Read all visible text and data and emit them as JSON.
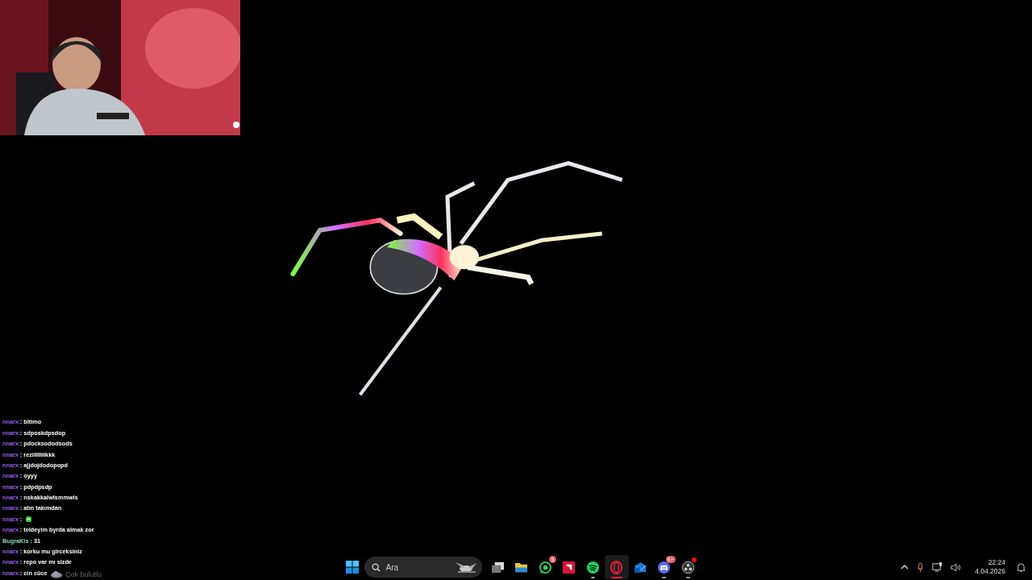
{
  "chat": [
    {
      "user": "nnarx",
      "color": "#9b5cf6",
      "kind": "text",
      "separator": ":",
      "message": "bitimo"
    },
    {
      "user": "nnarx",
      "color": "#9b5cf6",
      "kind": "text",
      "separator": ":",
      "message": "sdposkdpsdop"
    },
    {
      "user": "nnarx",
      "color": "#9b5cf6",
      "kind": "text",
      "separator": ":",
      "message": "pdocksododsods"
    },
    {
      "user": "nnarx",
      "color": "#9b5cf6",
      "kind": "text",
      "separator": ":",
      "message": "rezillllliikkk"
    },
    {
      "user": "nnarx",
      "color": "#9b5cf6",
      "kind": "text",
      "separator": ":",
      "message": "ajjdojdodopopd"
    },
    {
      "user": "nnarx",
      "color": "#9b5cf6",
      "kind": "text",
      "separator": ":",
      "message": "oyyy"
    },
    {
      "user": "nnarx",
      "color": "#9b5cf6",
      "kind": "text",
      "separator": ":",
      "message": "pdpdpsdp"
    },
    {
      "user": "nnarx",
      "color": "#9b5cf6",
      "kind": "text",
      "separator": ":",
      "message": "nskakkalwlsmmwls"
    },
    {
      "user": "nnarx",
      "color": "#9b5cf6",
      "kind": "text",
      "separator": ":",
      "message": "atın takımdan"
    },
    {
      "user": "nnarx",
      "color": "#9b5cf6",
      "kind": "emote",
      "separator": ":"
    },
    {
      "user": "nnarx",
      "color": "#9b5cf6",
      "kind": "text",
      "separator": ":",
      "message": "teldeyim byrda almak zor"
    },
    {
      "user": "BugraKls",
      "color": "#7fe0b8",
      "kind": "text",
      "separator": ":",
      "message": "31"
    },
    {
      "user": "nnarx",
      "color": "#9b5cf6",
      "kind": "text",
      "separator": ":",
      "message": "korku mu girceksiniz"
    },
    {
      "user": "nnarx",
      "color": "#9b5cf6",
      "kind": "text",
      "separator": ":",
      "message": "repo var mı sizde"
    },
    {
      "user": "nnarx",
      "color": "#9b5cf6",
      "kind": "text",
      "separator": ":",
      "message": "cin cüce"
    }
  ],
  "weather": {
    "text": "Çok bulutlu"
  },
  "taskbar": {
    "search": {
      "placeholder": "Ara"
    },
    "apps": [
      {
        "kind": "taskview",
        "running": false,
        "selected": false
      },
      {
        "kind": "folder",
        "running": false,
        "selected": false
      },
      {
        "kind": "whatsapp",
        "running": false,
        "selected": false,
        "badge": "9"
      },
      {
        "kind": "amd",
        "running": false,
        "selected": false
      },
      {
        "kind": "spotify",
        "running": true,
        "selected": false
      },
      {
        "kind": "opera",
        "running": true,
        "selected": true
      },
      {
        "kind": "mail",
        "running": false,
        "selected": false
      },
      {
        "kind": "discord",
        "running": true,
        "selected": false,
        "badge": "9+"
      },
      {
        "kind": "obs",
        "running": true,
        "selected": false,
        "dot": true
      }
    ]
  },
  "tray": {
    "time": "22:24",
    "date": "4.04.2026"
  }
}
